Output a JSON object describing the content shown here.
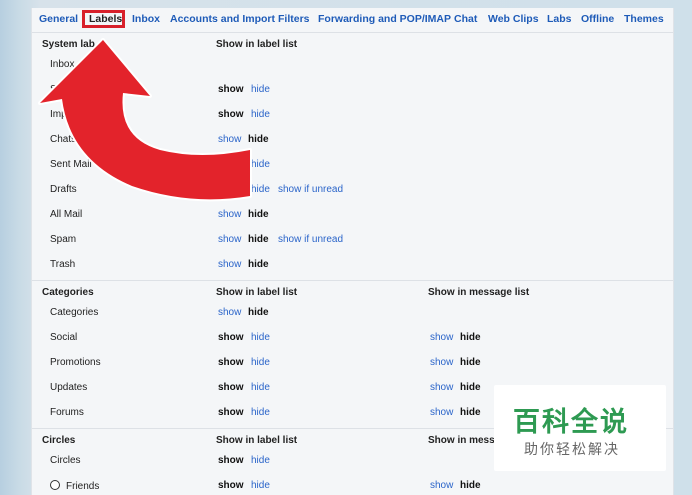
{
  "tabs": [
    "General",
    "Labels",
    "Inbox",
    "Accounts and Import",
    "Filters",
    "Forwarding and POP/IMAP",
    "Chat",
    "Web Clips",
    "Labs",
    "Offline",
    "Themes"
  ],
  "system_labels": {
    "title": "System lab",
    "col_label_list": "Show in label list",
    "rows": [
      {
        "name": "Inbox"
      },
      {
        "name": "St",
        "show": "show",
        "hide": "hide"
      },
      {
        "name": "Importan",
        "show": "show",
        "hide": "hide"
      },
      {
        "name": "Chats",
        "show": "show",
        "hide": "hide"
      },
      {
        "name": "Sent Mail",
        "hide": "hide"
      },
      {
        "name": "Drafts",
        "show": "show",
        "hide": "hide",
        "unread": "show if unread"
      },
      {
        "name": "All Mail",
        "show": "show",
        "hide": "hide"
      },
      {
        "name": "Spam",
        "show": "show",
        "hide": "hide",
        "unread": "show if unread"
      },
      {
        "name": "Trash",
        "show": "show",
        "hide": "hide"
      }
    ]
  },
  "categories": {
    "title": "Categories",
    "col_label_list": "Show in label list",
    "col_message_list": "Show in message list",
    "rows": [
      {
        "name": "Categories",
        "show": "show",
        "hide": "hide"
      },
      {
        "name": "Social",
        "show": "show",
        "hide": "hide",
        "m_show": "show",
        "m_hide": "hide"
      },
      {
        "name": "Promotions",
        "show": "show",
        "hide": "hide",
        "m_show": "show",
        "m_hide": "hide"
      },
      {
        "name": "Updates",
        "show": "show",
        "hide": "hide",
        "m_show": "show",
        "m_hide": "hide"
      },
      {
        "name": "Forums",
        "show": "show",
        "hide": "hide",
        "m_show": "show",
        "m_hide": "hide"
      }
    ]
  },
  "circles": {
    "title": "Circles",
    "col_label_list": "Show in label list",
    "col_message_list": "Show in messa",
    "rows": [
      {
        "name": "Circles",
        "show": "show",
        "hide": "hide"
      },
      {
        "name": "Friends",
        "show": "show",
        "hide": "hide",
        "m_show": "show",
        "m_hide": "hide"
      }
    ]
  },
  "watermark": {
    "main": "百科全说",
    "sub": "助你轻松解决"
  },
  "colors": {
    "link": "#2a64c9",
    "highlight": "#d8202a",
    "arrow": "#e3232b",
    "watermark": "#2e9a52"
  }
}
